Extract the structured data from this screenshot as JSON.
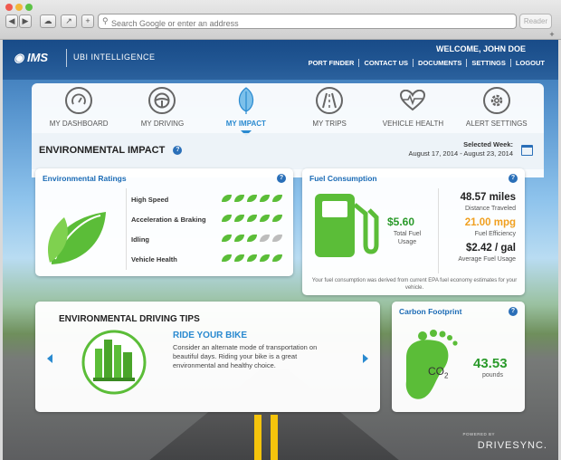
{
  "browser": {
    "address_placeholder": "Search Google or enter an address",
    "reader_label": "Reader"
  },
  "header": {
    "logo": "IMS",
    "product": "UBI INTELLIGENCE",
    "welcome": "WELCOME, JOHN DOE",
    "nav": [
      "PORT FINDER",
      "CONTACT US",
      "DOCUMENTS",
      "SETTINGS",
      "LOGOUT"
    ]
  },
  "tabs": [
    {
      "label": "MY DASHBOARD",
      "icon": "dashboard-gauge-icon"
    },
    {
      "label": "MY DRIVING",
      "icon": "steering-wheel-icon"
    },
    {
      "label": "MY IMPACT",
      "icon": "leaf-icon"
    },
    {
      "label": "MY TRIPS",
      "icon": "road-icon"
    },
    {
      "label": "VEHICLE HEALTH",
      "icon": "heartbeat-icon"
    },
    {
      "label": "ALERT SETTINGS",
      "icon": "gear-icon"
    }
  ],
  "active_tab": "MY IMPACT",
  "environmental": {
    "title": "ENVIRONMENTAL IMPACT",
    "selected_week_label": "Selected Week:",
    "selected_week_range": "August 17, 2014 - August 23, 2014"
  },
  "ratings": {
    "title": "Environmental Ratings",
    "max_leaves": 5,
    "rows": [
      {
        "label": "High Speed",
        "score": 5
      },
      {
        "label": "Acceleration & Braking",
        "score": 5
      },
      {
        "label": "Idling",
        "score": 3
      },
      {
        "label": "Vehicle Health",
        "score": 5
      }
    ]
  },
  "fuel": {
    "title": "Fuel Consumption",
    "total_cost": "$5.60",
    "total_cost_label": "Total Fuel Usage",
    "distance": "48.57 miles",
    "distance_label": "Distance Traveled",
    "efficiency": "21.00 mpg",
    "efficiency_label": "Fuel Efficiency",
    "avg_cost": "$2.42 / gal",
    "avg_cost_label": "Average Fuel Usage",
    "note": "Your fuel consumption was derived from current EPA fuel economy estimates for your vehicle."
  },
  "tips": {
    "title": "ENVIRONMENTAL DRIVING TIPS",
    "headline": "RIDE YOUR BIKE",
    "text": "Consider an alternate mode of transportation on beautiful days. Riding your bike is a great environmental and healthy choice."
  },
  "carbon": {
    "title": "Carbon Footprint",
    "co2_label": "CO",
    "co2_sub": "2",
    "value": "43.53",
    "unit": "pounds"
  },
  "footer": {
    "powered": "POWERED BY",
    "brand": "DRIVESYNC."
  },
  "colors": {
    "accent_blue": "#2a8ad0",
    "leaf_green": "#5bbd38",
    "value_green": "#2a9a2a",
    "efficiency_orange": "#f0a020"
  }
}
